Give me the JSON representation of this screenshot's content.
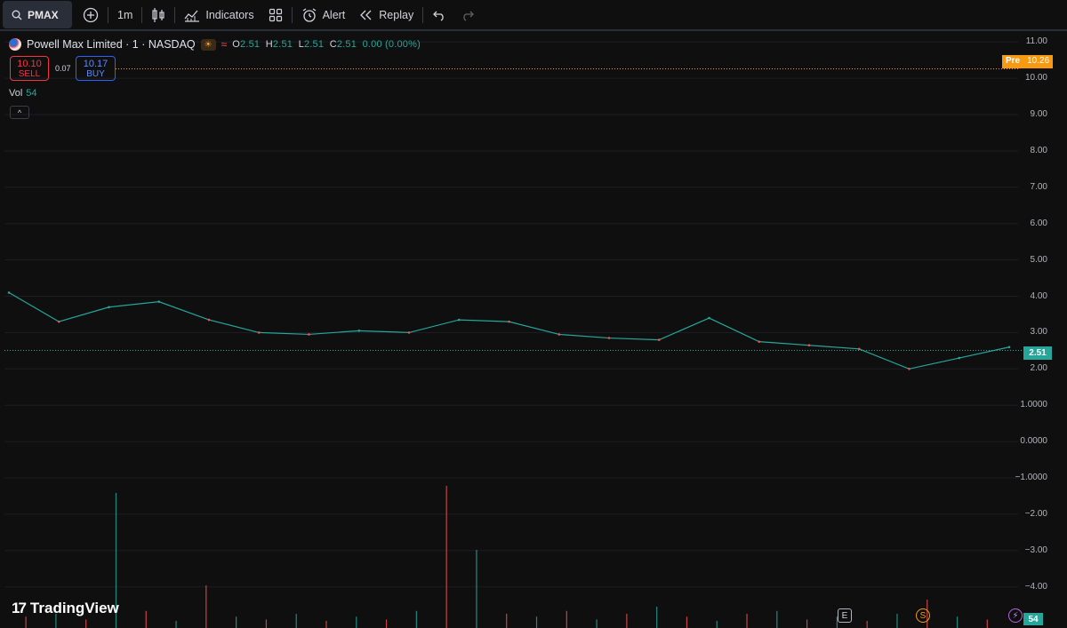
{
  "toolbar": {
    "symbol": "PMAX",
    "interval": "1m",
    "indicators_label": "Indicators",
    "alert_label": "Alert",
    "replay_label": "Replay"
  },
  "legend": {
    "title": "Powell Max Limited · 1 · NASDAQ",
    "o_key": "O",
    "o_val": "2.51",
    "h_key": "H",
    "h_val": "2.51",
    "l_key": "L",
    "l_val": "2.51",
    "c_key": "C",
    "c_val": "2.51",
    "change": "0.00 (0.00%)"
  },
  "trade": {
    "sell_price": "10.10",
    "sell_label": "SELL",
    "spread": "0.07",
    "buy_price": "10.17",
    "buy_label": "BUY"
  },
  "volume": {
    "label": "Vol",
    "value": "54"
  },
  "price_axis": [
    "11.00",
    "10.00",
    "9.00",
    "8.00",
    "7.00",
    "6.00",
    "5.00",
    "4.00",
    "3.00",
    "2.00",
    "1.0000",
    "0.0000",
    "−1.0000",
    "−2.00",
    "−3.00",
    "−4.00"
  ],
  "premarket": {
    "label": "Pre",
    "value": "10.26"
  },
  "last_price": "2.51",
  "last_volume": "54",
  "events": {
    "earnings": "E",
    "split": "S"
  },
  "brand": "TradingView",
  "colors": {
    "up": "#26a69a",
    "down": "#ef5350",
    "premarket": "#f79a11",
    "background": "#0f0f0f"
  },
  "chart_data": {
    "type": "line",
    "x": [
      0,
      5,
      10,
      15,
      20,
      25,
      30,
      35,
      40,
      45,
      50,
      55,
      60,
      65,
      70,
      75,
      80,
      85,
      90,
      95,
      100
    ],
    "series": [
      {
        "values": [
          4.1,
          3.3,
          3.7,
          3.85,
          3.35,
          3.0,
          2.95,
          3.05,
          3.0,
          3.35,
          3.3,
          2.95,
          2.85,
          2.8,
          3.4,
          2.75,
          2.65,
          2.55,
          2.0,
          2.3,
          2.6
        ]
      }
    ],
    "ylim": [
      -4.3,
      11.2
    ],
    "premarket_line": 10.26,
    "last_line": 2.51,
    "volume": [
      0.08,
      0.1,
      0.06,
      0.95,
      0.12,
      0.05,
      0.3,
      0.08,
      0.06,
      0.1,
      0.05,
      0.08,
      0.06,
      0.12,
      1.0,
      0.55,
      0.1,
      0.08,
      0.12,
      0.06,
      0.1,
      0.15,
      0.08,
      0.05,
      0.1,
      0.12,
      0.06,
      0.08,
      0.05,
      0.1,
      0.2,
      0.08,
      0.06
    ]
  }
}
